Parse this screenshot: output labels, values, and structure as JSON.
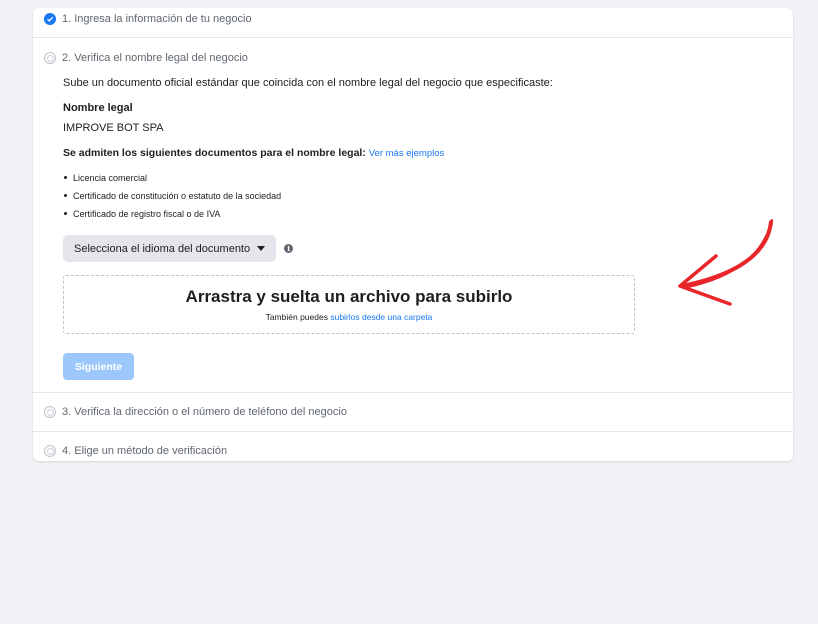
{
  "steps": {
    "step1": {
      "label": "1. Ingresa la información de tu negocio"
    },
    "step2": {
      "label": "2. Verifica el nombre legal del negocio",
      "intro": "Sube un documento oficial estándar que coincida con el nombre legal del negocio que especificaste:",
      "legal_name_label": "Nombre legal",
      "legal_name_value": "IMPROVE BOT SPA",
      "docs_title": "Se admiten los siguientes documentos para el nombre legal:",
      "docs_link": "Ver más ejemplos",
      "docs": [
        "Licencia comercial",
        "Certificado de constitución o estatuto de la sociedad",
        "Certificado de registro fiscal o de IVA"
      ],
      "language_select": "Selecciona el idioma del documento",
      "dropzone_title": "Arrastra y suelta un archivo para subirlo",
      "dropzone_sub_prefix": "También puedes",
      "dropzone_sub_link": "subirlos desde una carpeta",
      "next_button": "Siguiente"
    },
    "step3": {
      "label": "3. Verifica la dirección o el número de teléfono del negocio"
    },
    "step4": {
      "label": "4. Elige un método de verificación"
    }
  },
  "colors": {
    "accent": "#1877f2",
    "disabled_button": "#9cc7fb",
    "annotation_arrow": "#e8262a"
  },
  "icons": {
    "step_done": "check-circle-icon",
    "step_pending": "radio-circle-icon",
    "info": "info-icon",
    "dropdown": "caret-down-icon",
    "annotation": "red-arrow-icon"
  }
}
